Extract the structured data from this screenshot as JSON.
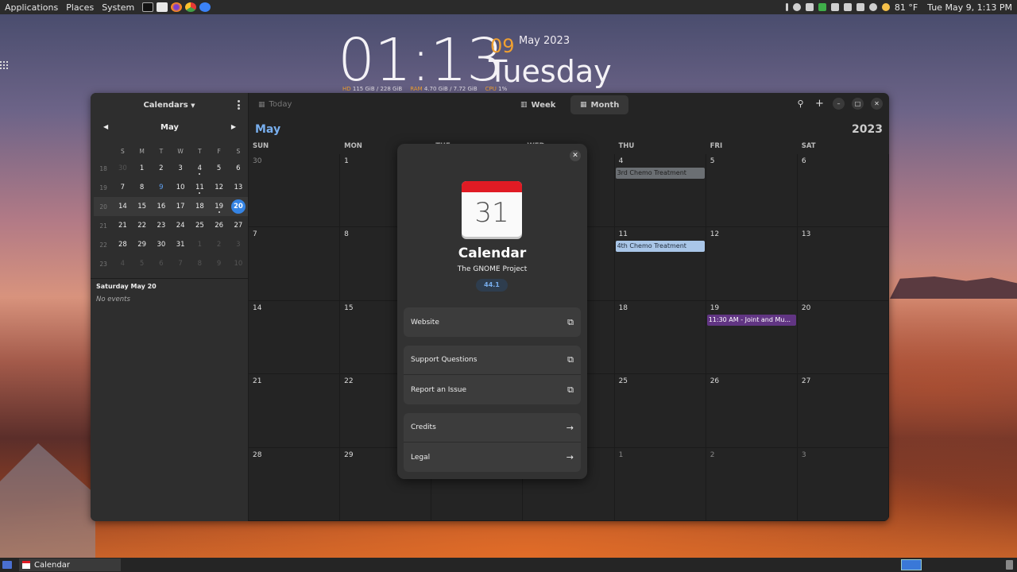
{
  "panel": {
    "applications": "Applications",
    "places": "Places",
    "system": "System",
    "weather": "81 °F",
    "datetime": "Tue May 9,  1:13 PM"
  },
  "widget": {
    "time": "01:13",
    "day": "09",
    "month": "May 2023",
    "weekday": "Tuesday",
    "stats": [
      {
        "label": "HD",
        "value": "115 GiB / 228 GiB"
      },
      {
        "label": "RAM",
        "value": "4.70 GiB / 7.72 GiB"
      },
      {
        "label": "CPU",
        "value": "1%"
      }
    ]
  },
  "sidebar": {
    "calendars_label": "Calendars",
    "month": "May",
    "weekdays": [
      "S",
      "M",
      "T",
      "W",
      "T",
      "F",
      "S"
    ],
    "weeks": [
      {
        "wk": "18",
        "days": [
          "30",
          "1",
          "2",
          "3",
          "4",
          "5",
          "6"
        ]
      },
      {
        "wk": "19",
        "days": [
          "7",
          "8",
          "9",
          "10",
          "11",
          "12",
          "13"
        ]
      },
      {
        "wk": "20",
        "days": [
          "14",
          "15",
          "16",
          "17",
          "18",
          "19",
          "20"
        ]
      },
      {
        "wk": "21",
        "days": [
          "21",
          "22",
          "23",
          "24",
          "25",
          "26",
          "27"
        ]
      },
      {
        "wk": "22",
        "days": [
          "28",
          "29",
          "30",
          "31",
          "1",
          "2",
          "3"
        ]
      },
      {
        "wk": "23",
        "days": [
          "4",
          "5",
          "6",
          "7",
          "8",
          "9",
          "10"
        ]
      }
    ],
    "selected_date": "Saturday May 20",
    "no_events": "No events"
  },
  "header": {
    "today": "Today",
    "week": "Week",
    "month": "Month"
  },
  "month_view": {
    "month": "May",
    "year": "2023",
    "dow": [
      "SUN",
      "MON",
      "TUE",
      "WED",
      "THU",
      "FRI",
      "SAT"
    ],
    "cells": [
      [
        "30",
        "1",
        "",
        "",
        "4",
        "5",
        "6"
      ],
      [
        "7",
        "8",
        "",
        "",
        "11",
        "12",
        "13"
      ],
      [
        "14",
        "15",
        "",
        "",
        "18",
        "19",
        "20"
      ],
      [
        "21",
        "22",
        "",
        "",
        "25",
        "26",
        "27"
      ],
      [
        "28",
        "29",
        "",
        "",
        "1",
        "2",
        "3"
      ]
    ],
    "events": [
      {
        "row": 0,
        "col": 4,
        "title": "3rd Chemo Treatment",
        "bg": "#6b6f73",
        "fg": "#1e1e1e"
      },
      {
        "row": 1,
        "col": 4,
        "title": "4th Chemo Treatment",
        "bg": "#a9c6e8",
        "fg": "#1e2a3a"
      },
      {
        "row": 2,
        "col": 5,
        "title": "11:30 AM - Joint and Mu...",
        "bg": "#613583",
        "fg": "#ffffff"
      }
    ]
  },
  "about": {
    "icon_number": "31",
    "app_name": "Calendar",
    "developer": "The GNOME Project",
    "version": "44.1",
    "website": "Website",
    "support": "Support Questions",
    "report": "Report an Issue",
    "credits": "Credits",
    "legal": "Legal"
  },
  "taskbar": {
    "window": "Calendar"
  },
  "colors": {
    "accent": "#3584e4",
    "month_title": "#78aeed",
    "calendar_red": "#e01b24"
  }
}
